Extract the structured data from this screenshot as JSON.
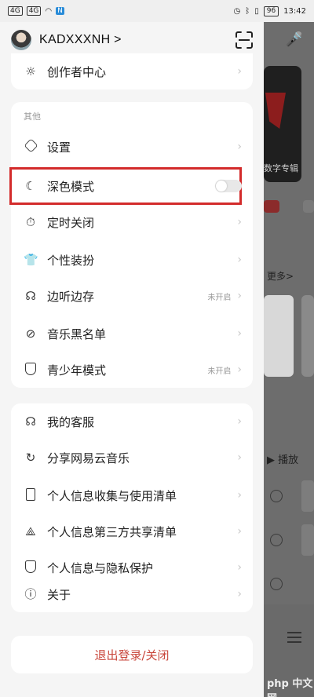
{
  "status_bar": {
    "left_signal_1": "4G",
    "left_signal_2": "4G",
    "nfc": "N",
    "battery": "96",
    "time": "13:42"
  },
  "drawer": {
    "username": "KADXXXNH >",
    "top_item": {
      "label": "创作者中心",
      "icon": "bulb-icon"
    },
    "other_section_title": "其他",
    "other_items": [
      {
        "label": "设置",
        "icon": "settings-hex-icon",
        "status": ""
      },
      {
        "label": "深色模式",
        "icon": "moon-icon",
        "status": "",
        "toggle": false
      },
      {
        "label": "定时关闭",
        "icon": "timer-icon",
        "status": ""
      },
      {
        "label": "个性装扮",
        "icon": "tshirt-icon",
        "status": ""
      },
      {
        "label": "边听边存",
        "icon": "headphones-icon",
        "status": "未开启"
      },
      {
        "label": "音乐黑名单",
        "icon": "block-icon",
        "status": ""
      },
      {
        "label": "青少年模式",
        "icon": "shield-check-icon",
        "status": "未开启"
      }
    ],
    "service_items": [
      {
        "label": "我的客服",
        "icon": "headset-icon"
      },
      {
        "label": "分享网易云音乐",
        "icon": "share-icon"
      },
      {
        "label": "个人信息收集与使用清单",
        "icon": "doc-icon"
      },
      {
        "label": "个人信息第三方共享清单",
        "icon": "share-cloud-icon"
      },
      {
        "label": "个人信息与隐私保护",
        "icon": "privacy-shield-icon"
      },
      {
        "label": "关于",
        "icon": "info-icon"
      }
    ],
    "logout_label": "退出登录/关闭"
  },
  "background": {
    "more_label": "更多>",
    "play_label": "播放",
    "card_label": "数字专辑",
    "watermark": "php 中文网"
  }
}
